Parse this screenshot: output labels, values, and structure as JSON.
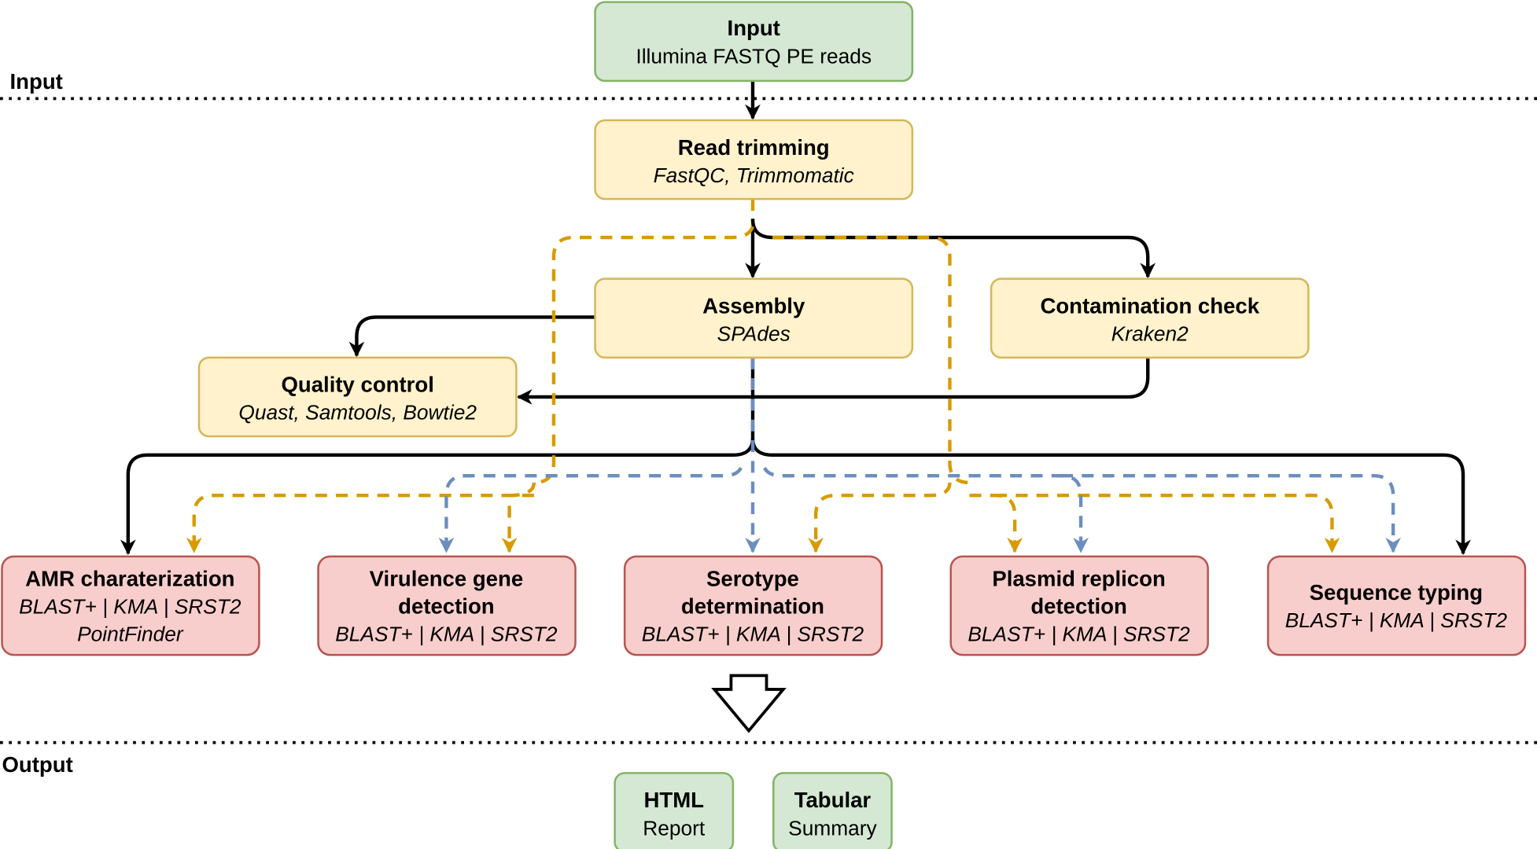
{
  "sections": {
    "input": "Input",
    "output": "Output"
  },
  "nodes": {
    "input": {
      "title": "Input",
      "sub": "Illumina FASTQ PE reads"
    },
    "trim": {
      "title": "Read trimming",
      "sub": "FastQC, Trimmomatic"
    },
    "assembly": {
      "title": "Assembly",
      "sub": "SPAdes"
    },
    "contam": {
      "title": "Contamination check",
      "sub": "Kraken2"
    },
    "qc": {
      "title": "Quality control",
      "sub": "Quast, Samtools, Bowtie2"
    },
    "amr": {
      "title": "AMR charaterization",
      "sub1": "BLAST+ | KMA | SRST2",
      "sub2": "PointFinder"
    },
    "vir": {
      "title1": "Virulence gene",
      "title2": "detection",
      "sub": "BLAST+ | KMA | SRST2"
    },
    "sero": {
      "title1": "Serotype",
      "title2": "determination",
      "sub": "BLAST+ | KMA | SRST2"
    },
    "plas": {
      "title1": "Plasmid replicon",
      "title2": "detection",
      "sub": "BLAST+ | KMA | SRST2"
    },
    "seq": {
      "title": "Sequence typing",
      "sub": "BLAST+ | KMA | SRST2"
    },
    "html": {
      "title": "HTML",
      "sub": "Report"
    },
    "tab": {
      "title": "Tabular",
      "sub": "Summary"
    }
  },
  "colors": {
    "input_output": "#d5e8d4",
    "processing": "#fff2cc",
    "analysis": "#f8cecc",
    "assembly_flow": "#d79b00",
    "reads_flow": "#6c8ebf"
  }
}
